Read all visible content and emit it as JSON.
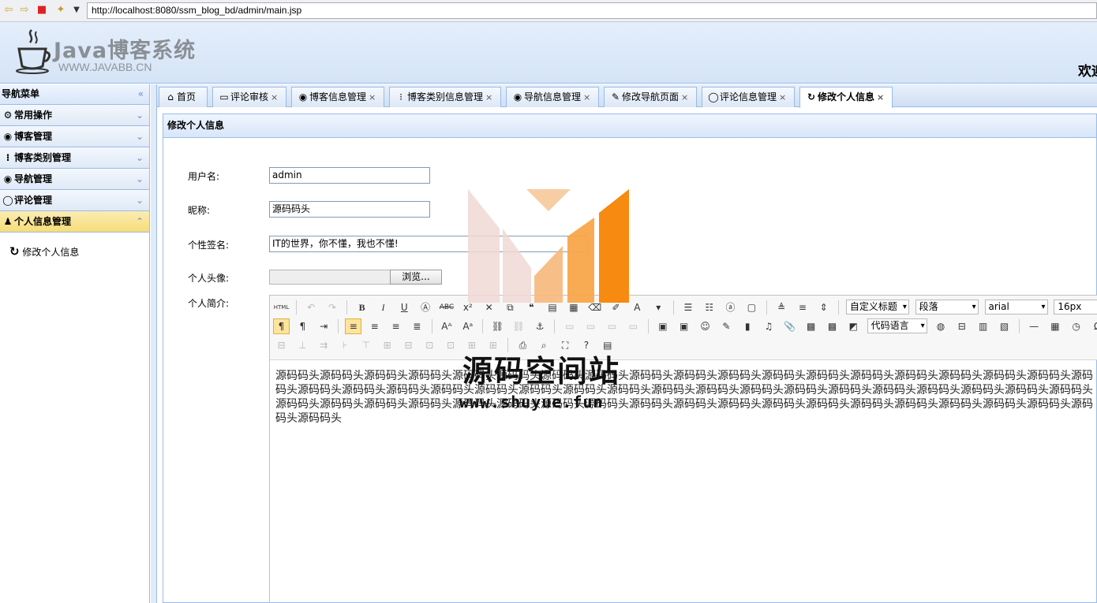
{
  "browser": {
    "url": "http://localhost:8080/ssm_blog_bd/admin/main.jsp"
  },
  "header": {
    "title": "Java博客系统",
    "subtitle": "WWW.JAVABB.CN",
    "welcome": "欢迎"
  },
  "sidebar": {
    "title": "导航菜单",
    "items": [
      {
        "label": "常用操作"
      },
      {
        "label": "博客管理"
      },
      {
        "label": "博客类别管理"
      },
      {
        "label": "导航管理"
      },
      {
        "label": "评论管理"
      },
      {
        "label": "个人信息管理"
      }
    ],
    "sub_item": "修改个人信息"
  },
  "tabs": [
    {
      "label": "首页"
    },
    {
      "label": "评论审核"
    },
    {
      "label": "博客信息管理"
    },
    {
      "label": "博客类别信息管理"
    },
    {
      "label": "导航信息管理"
    },
    {
      "label": "修改导航页面"
    },
    {
      "label": "评论信息管理"
    },
    {
      "label": "修改个人信息"
    }
  ],
  "panel": {
    "title": "修改个人信息"
  },
  "form": {
    "username_label": "用户名:",
    "username_value": "admin",
    "nickname_label": "昵称:",
    "nickname_value": "源码码头",
    "sign_label": "个性签名:",
    "sign_value": "IT的世界，你不懂，我也不懂!",
    "avatar_label": "个人头像:",
    "browse_label": "浏览...",
    "profile_label": "个人简介:"
  },
  "editor": {
    "html_label": "HTML",
    "title_select": "自定义标题",
    "paragraph_select": "段落",
    "font_select": "arial",
    "size_select": "16px",
    "code_select": "代码语言",
    "content": "源码码头源码码头源码码头源码码头源码码头源码码头源码码头源码码头源码码头源码码头源码码头源码码头源码码头源码码头源码码头源码码头源码码头源码码头源码码头源码码头源码码头源码码头源码码头源码码头源码码头源码码头源码码头源码码头源码码头源码码头源码码头源码码头源码码头源码码头源码码头源码码头源码码头源码码头源码码头源码码头源码码头源码码头源码码头源码码头源码码头源码码头源码码头源码码头源码码头源码码头源码码头源码码头源码码头源码码头源码码头源码码头源码码头"
  },
  "watermark": {
    "text": "源码空间站",
    "url": "www.shuyue.fun"
  }
}
